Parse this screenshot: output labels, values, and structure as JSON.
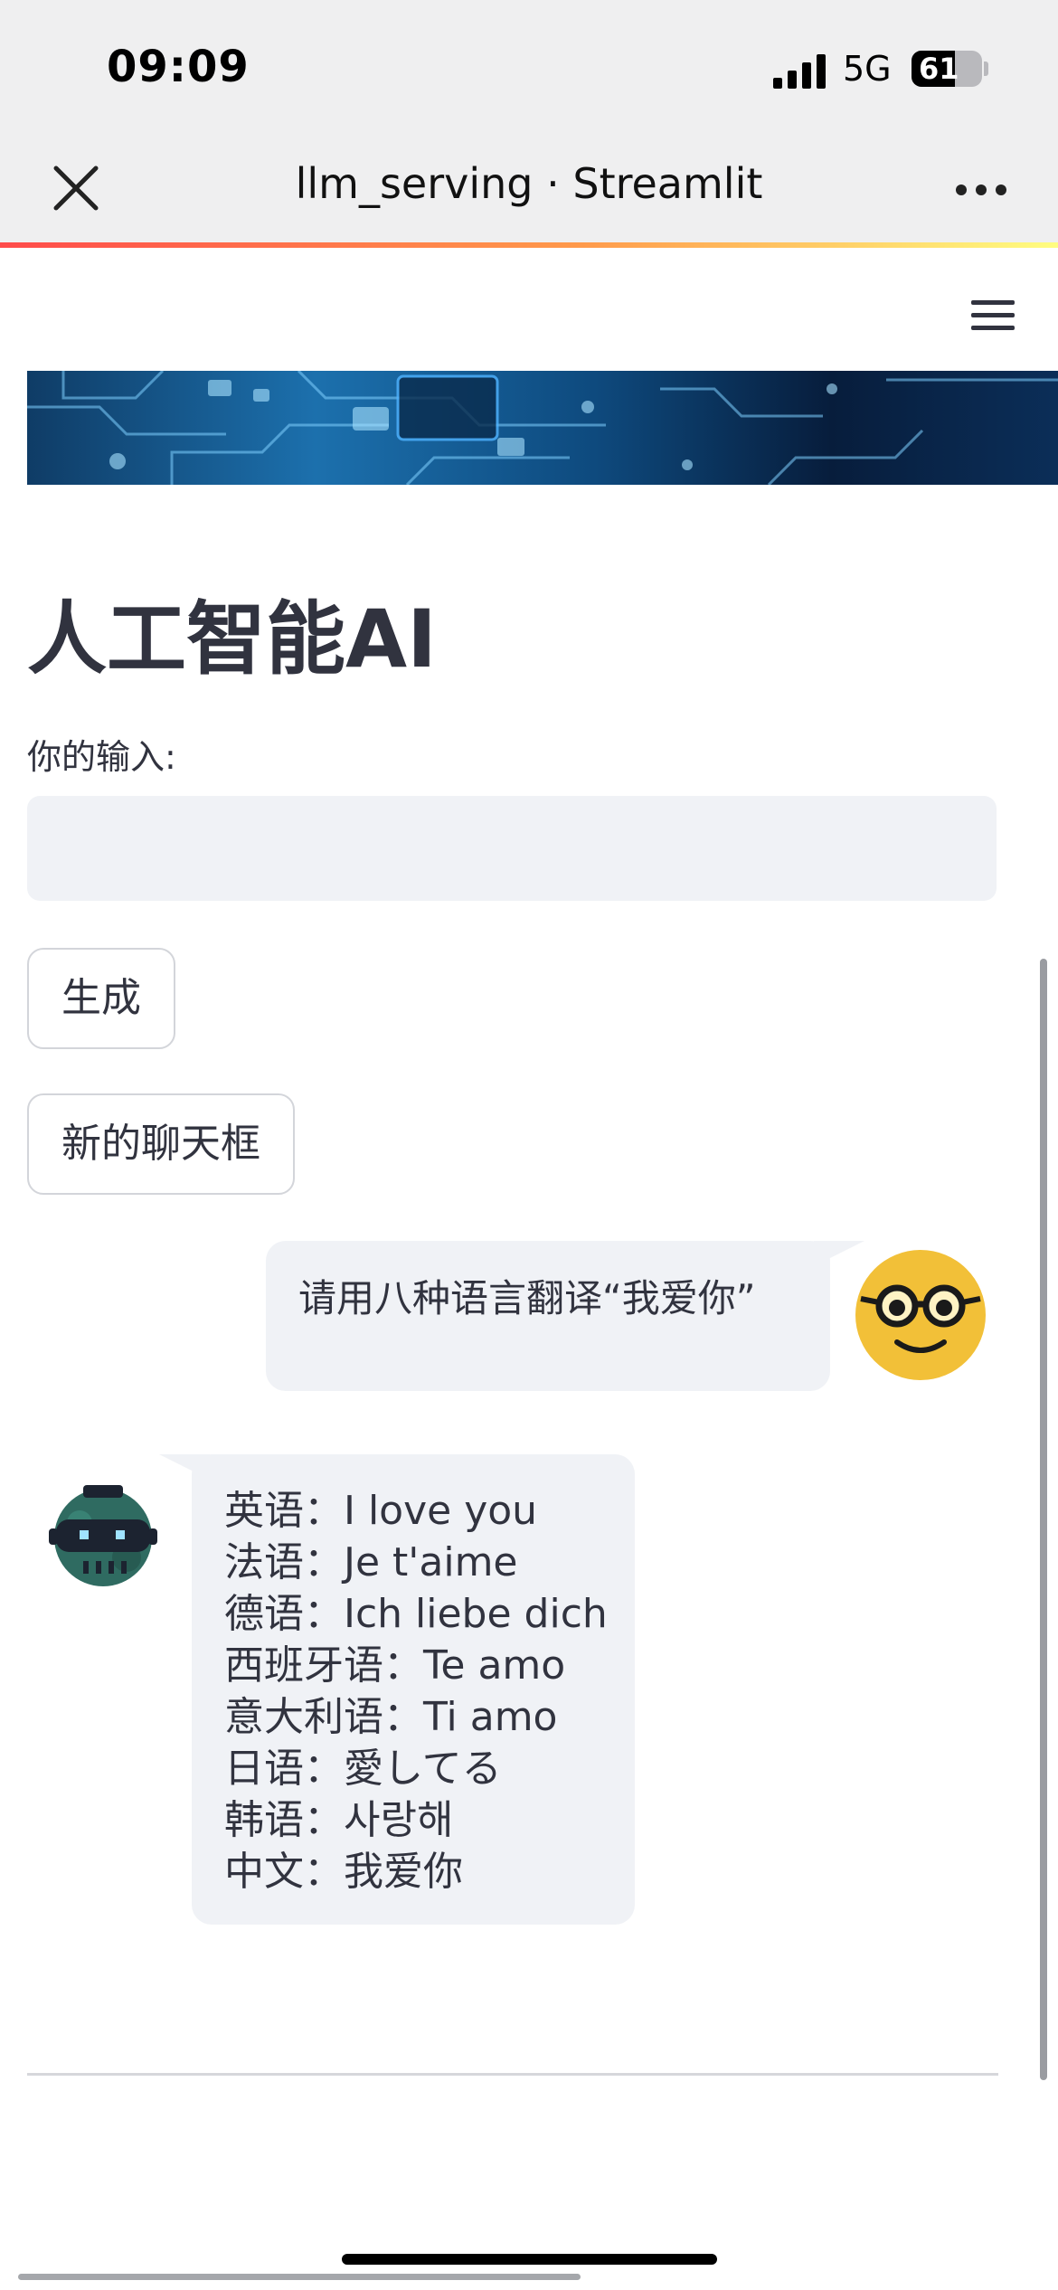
{
  "status_bar": {
    "time": "09:09",
    "network": "5G",
    "battery": "61",
    "battery_level_percent": 61
  },
  "browser": {
    "title": "llm_serving · Streamlit",
    "close_icon": "close-icon",
    "more_icon": "more-dots-icon"
  },
  "app": {
    "menu_icon": "hamburger-menu-icon",
    "banner": "circuit-board-banner-image",
    "heading": "人工智能AI",
    "input_label": "你的输入:",
    "input_value": "",
    "generate_button": "生成",
    "new_chat_button": "新的聊天框"
  },
  "chat": {
    "user_message": "请用八种语言翻译“我爱你”",
    "user_avatar": "nerd-face-avatar",
    "bot_avatar": "robot-avatar",
    "bot_lines": [
      "英语：I love you",
      "法语：Je t'aime",
      "德语：Ich liebe dich",
      "西班牙语：Te amo",
      "意大利语：Ti amo",
      "日语：愛してる",
      "韩语：사랑해",
      "中文：我爱你"
    ]
  },
  "colors": {
    "chrome_bg": "#efeff0",
    "text": "#31333f",
    "bubble_bg": "#f0f2f6",
    "accent_red": "#ff4b4b",
    "accent_yellow": "#fffd80",
    "avatar_yellow": "#f2c038"
  }
}
